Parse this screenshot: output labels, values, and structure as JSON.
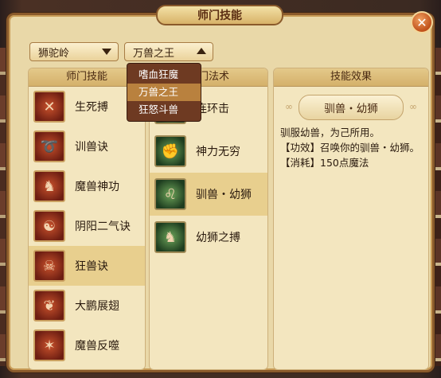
{
  "window": {
    "title": "师门技能"
  },
  "dropdowns": {
    "school": {
      "value": "狮驼岭"
    },
    "pet": {
      "value": "万兽之王",
      "options": [
        "嗜血狂魔",
        "万兽之王",
        "狂怒斗兽"
      ],
      "selected_index": 1
    }
  },
  "columns": {
    "school_skills": {
      "header": "师门技能",
      "items": [
        {
          "label": "生死搏",
          "icon": "crossed-blades-icon"
        },
        {
          "label": "训兽诀",
          "icon": "whip-icon"
        },
        {
          "label": "魔兽神功",
          "icon": "demon-beast-icon"
        },
        {
          "label": "阴阳二气诀",
          "icon": "yinyang-mask-icon"
        },
        {
          "label": "狂兽诀",
          "icon": "beast-skull-icon"
        },
        {
          "label": "大鹏展翅",
          "icon": "wings-icon"
        },
        {
          "label": "魔兽反噬",
          "icon": "demon-claw-icon"
        }
      ],
      "selected_index": 4
    },
    "school_spells": {
      "header": "师门法术",
      "items": [
        {
          "label": "连环击",
          "icon": "chain-strike-icon"
        },
        {
          "label": "神力无穷",
          "icon": "power-fist-icon"
        },
        {
          "label": "驯兽・幼狮",
          "icon": "lion-cub-icon"
        },
        {
          "label": "幼狮之搏",
          "icon": "lion-fight-icon"
        }
      ],
      "selected_index": 2
    },
    "effect": {
      "header": "技能效果",
      "title": "驯兽・幼狮",
      "lines": [
        "驯服幼兽，为己所用。",
        "【功效】召唤你的驯兽・幼狮。",
        "【消耗】150点魔法"
      ]
    }
  },
  "colors": {
    "panel_bg": "#e9d8a8",
    "selected_row": "#e8cf8e",
    "menu_bg": "#6e3a22",
    "menu_selected": "#b9813e"
  }
}
